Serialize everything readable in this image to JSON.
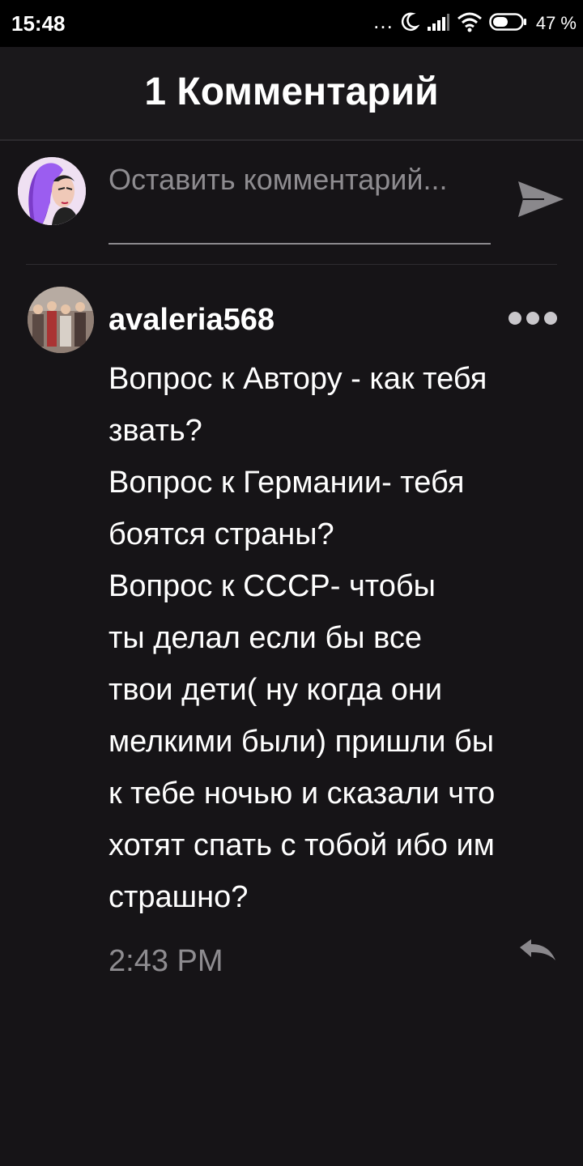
{
  "status_bar": {
    "time": "15:48",
    "dots": "...",
    "battery_percent": "47 %",
    "icons": [
      "moon-icon",
      "signal-icon",
      "wifi-icon",
      "battery-icon"
    ]
  },
  "header": {
    "title": "1 Комментарий"
  },
  "composer": {
    "placeholder": "Оставить комментарий...",
    "send_icon": "send-icon"
  },
  "comments": [
    {
      "author": "avaleria568",
      "text": "Вопрос к Автору - как тебя\nзвать?\nВопрос к Германии- тебя\nбоятся страны?\nВопрос к СССР- чтобы\nты делал если бы все\nтвои дети( ну когда они\nмелкими были) пришли бы\nк тебе ночью и сказали что\nхотят спать с тобой ибо им\nстрашно?",
      "time": "2:43 PM",
      "more_icon": "more-dots-icon",
      "reply_icon": "reply-icon"
    }
  ],
  "colors": {
    "background": "#161417",
    "header_background": "#1a181b",
    "text_primary": "#ffffff",
    "text_secondary": "#8e8c90",
    "divider": "#2f2d31"
  }
}
